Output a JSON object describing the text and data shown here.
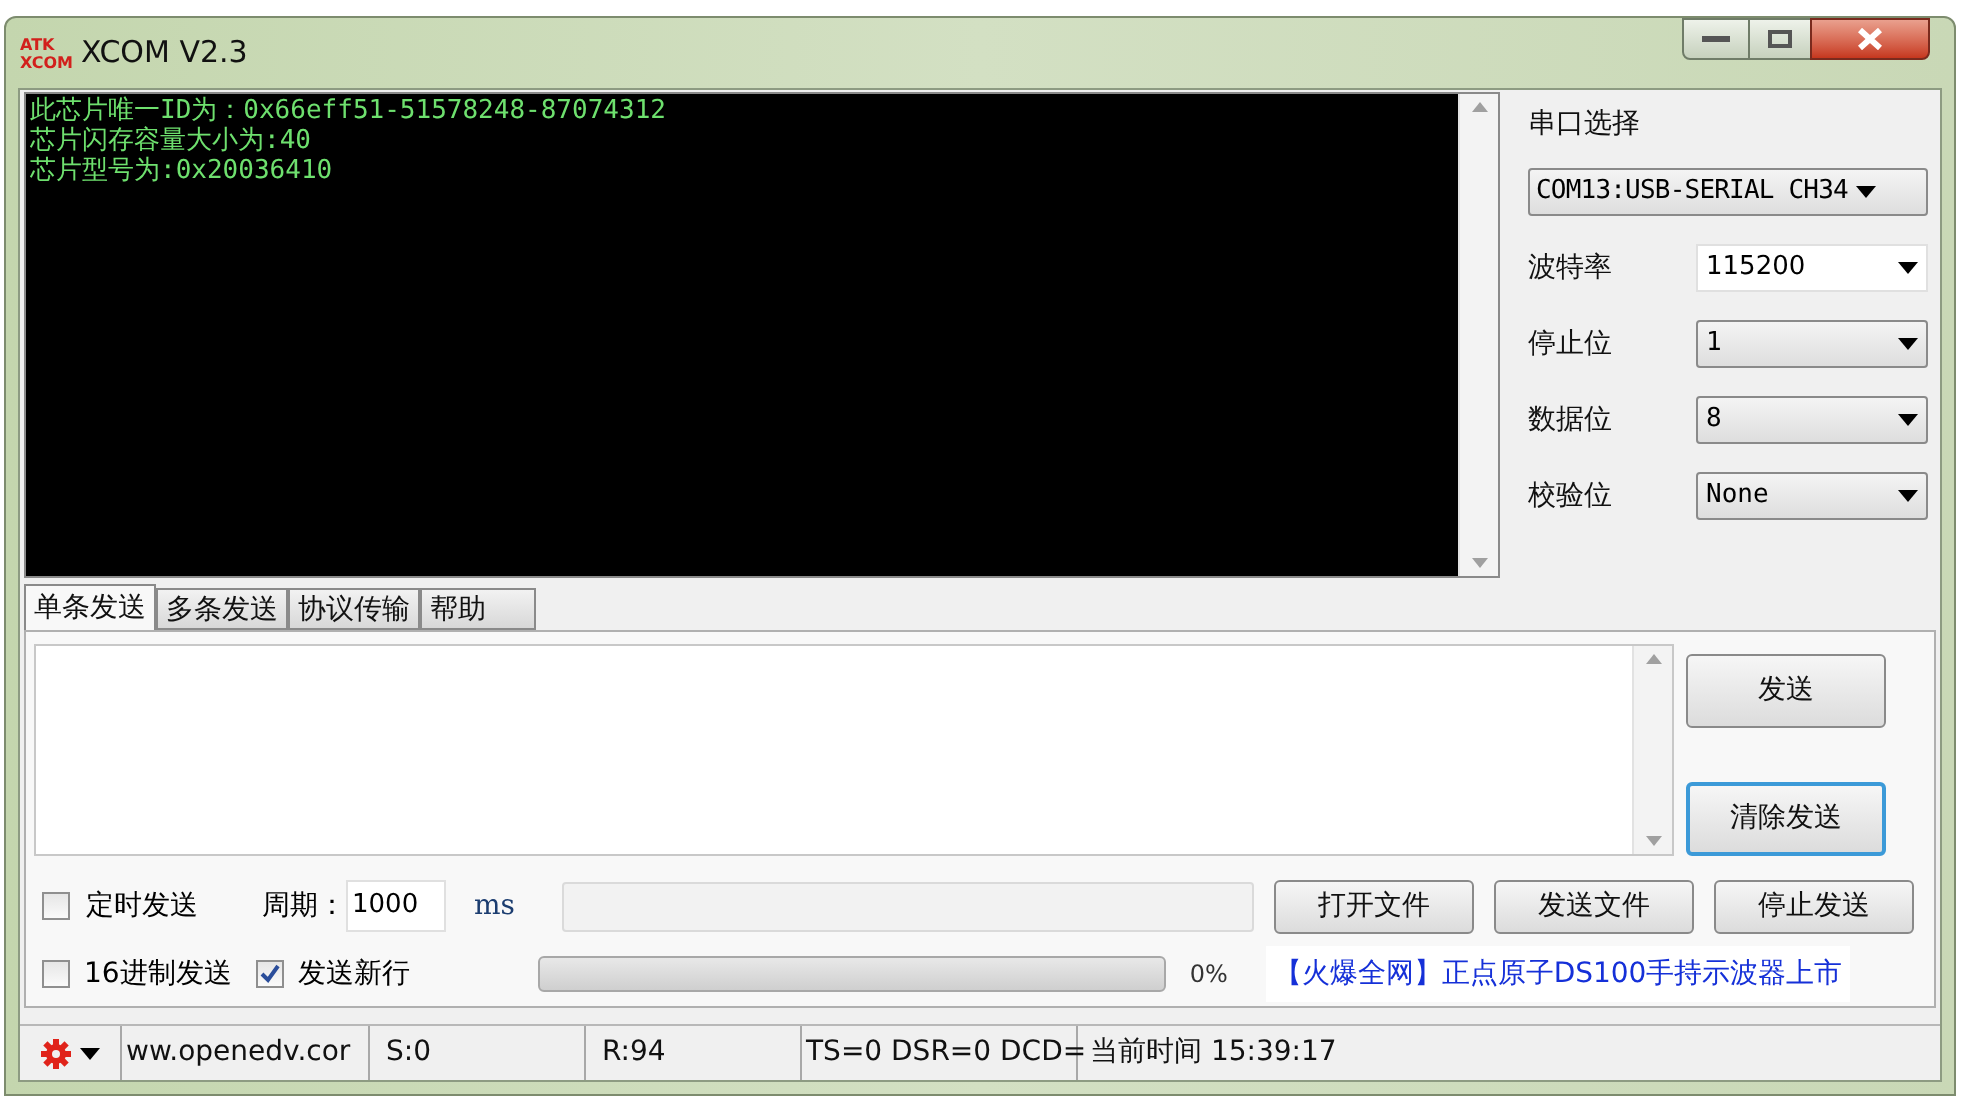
{
  "window": {
    "title": "XCOM V2.3",
    "logo": [
      "ATK",
      "XCOM"
    ]
  },
  "receive": {
    "lines": [
      "此芯片唯一ID为：0x66eff51-51578248-87074312",
      "芯片闪存容量大小为:40",
      "芯片型号为:0x20036410"
    ]
  },
  "serial": {
    "heading": "串口选择",
    "port": "COM13:USB-SERIAL CH34",
    "fields": [
      {
        "label": "波特率",
        "value": "115200",
        "kind": "editable"
      },
      {
        "label": "停止位",
        "value": "1",
        "kind": "list"
      },
      {
        "label": "数据位",
        "value": "8",
        "kind": "list"
      },
      {
        "label": "校验位",
        "value": "None",
        "kind": "list"
      }
    ]
  },
  "tabs": [
    {
      "label": "单条发送",
      "selected": true
    },
    {
      "label": "多条发送",
      "selected": false
    },
    {
      "label": "协议传输",
      "selected": false
    },
    {
      "label": "帮助",
      "selected": false
    }
  ],
  "send_buttons": [
    {
      "label": "发送",
      "focused": false
    },
    {
      "label": "清除发送",
      "focused": true
    }
  ],
  "timed_send": {
    "label": "定时发送",
    "checked": false
  },
  "period": {
    "label": "周期：",
    "value": "1000",
    "unit": "ms"
  },
  "file_buttons": [
    "打开文件",
    "发送文件",
    "停止发送"
  ],
  "options": [
    {
      "label": "16进制发送",
      "checked": false
    },
    {
      "label": "发送新行",
      "checked": true
    }
  ],
  "progress": {
    "level": 0,
    "reading": "0%"
  },
  "ad_link": "【火爆全网】正点原子DS100手持示波器上市",
  "status_bar": {
    "website": "ww.openedv.cor",
    "sent": "S:0",
    "received": "R:94",
    "lines": "TS=0 DSR=0 DCD=",
    "time": "当前时间 15:39:17"
  }
}
